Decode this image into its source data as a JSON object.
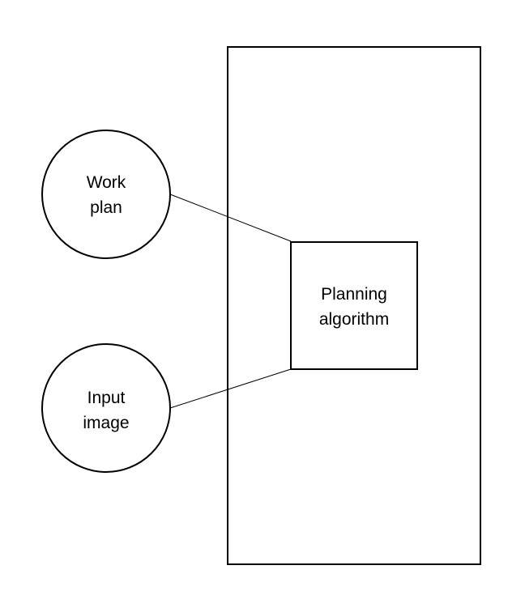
{
  "nodes": {
    "work_plan": {
      "line1": "Work",
      "line2": "plan"
    },
    "input_image": {
      "line1": "Input",
      "line2": "image"
    },
    "planning_algorithm": {
      "line1": "Planning",
      "line2": "algorithm"
    }
  },
  "colors": {
    "stroke": "#000000",
    "background": "#ffffff"
  }
}
